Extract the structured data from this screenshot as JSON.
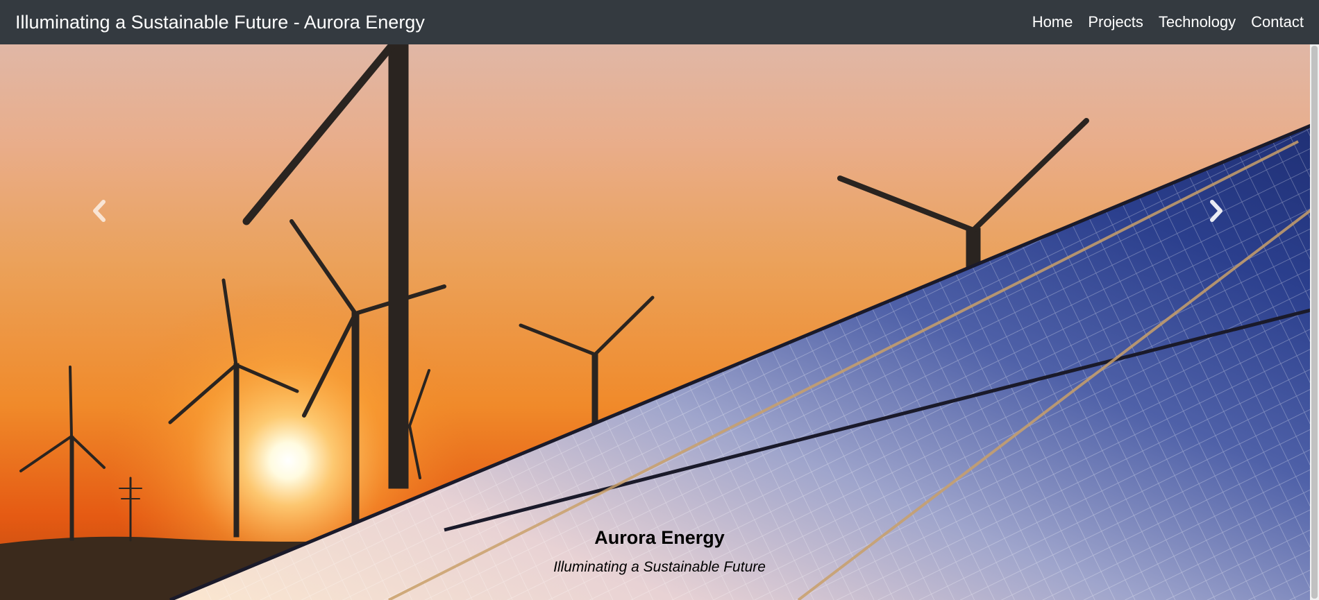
{
  "navbar": {
    "brand": "Illuminating a Sustainable Future - Aurora Energy",
    "links": [
      "Home",
      "Projects",
      "Technology",
      "Contact"
    ]
  },
  "carousel": {
    "image_icon": "solar-panels-and-wind-turbines-at-sunset-image",
    "prev_icon": "chevron-left-icon",
    "next_icon": "chevron-right-icon",
    "caption": {
      "title": "Aurora Energy",
      "subtitle": "Illuminating a Sustainable Future"
    }
  },
  "colors": {
    "navbar_bg": "#343a40",
    "nav_text": "#ffffff",
    "caption_text": "#000000"
  }
}
